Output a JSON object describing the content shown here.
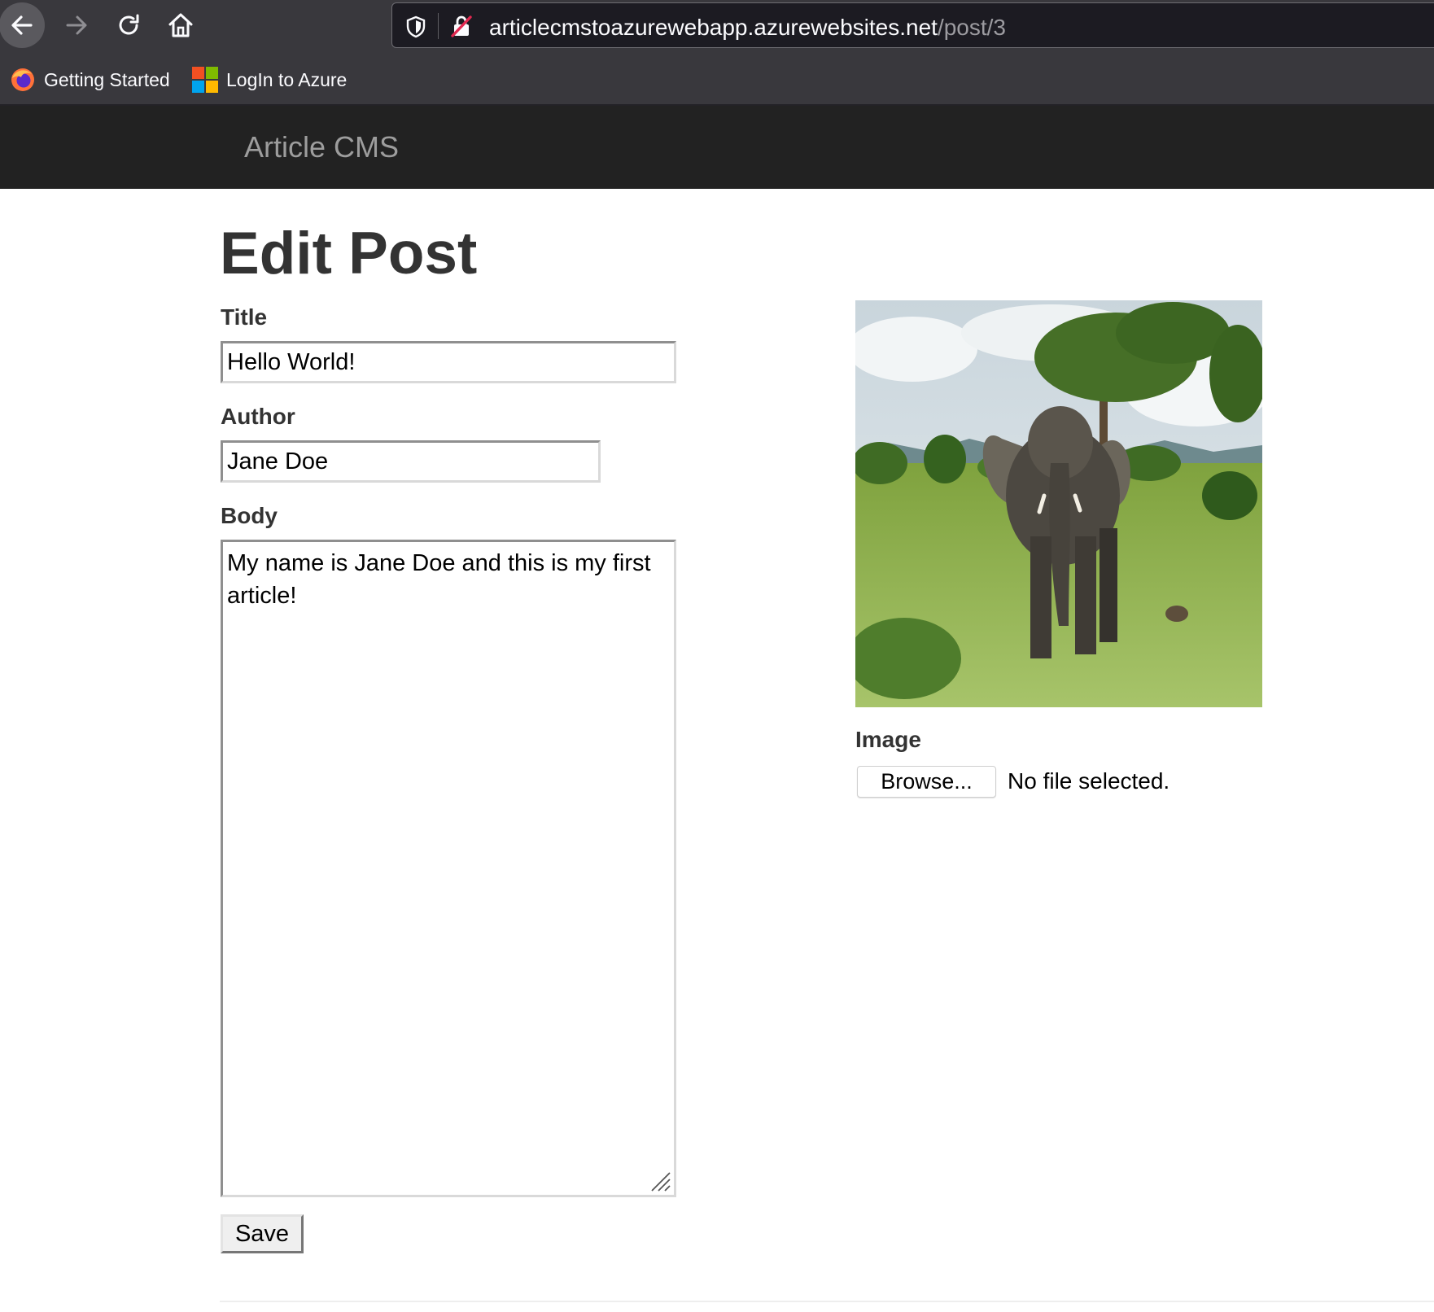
{
  "browser": {
    "url_host": "articlecmstoazurewebapp.azurewebsites.net",
    "url_path": "/post/3",
    "bookmarks": [
      {
        "label": "Getting Started",
        "icon": "firefox-icon"
      },
      {
        "label": "LogIn to Azure",
        "icon": "microsoft-logo-icon"
      }
    ],
    "colors": {
      "toolbar": "#39383d",
      "urlbar": "#1c1b22"
    }
  },
  "site": {
    "brand": "Article CMS",
    "nav_color": "#222222"
  },
  "page": {
    "title": "Edit Post"
  },
  "form": {
    "title_label": "Title",
    "title_value": "Hello World!",
    "author_label": "Author",
    "author_value": "Jane Doe",
    "body_label": "Body",
    "body_value": "My name is Jane Doe and this is my first article!",
    "save_label": "Save",
    "image_label": "Image",
    "browse_label": "Browse...",
    "file_status": "No file selected."
  }
}
